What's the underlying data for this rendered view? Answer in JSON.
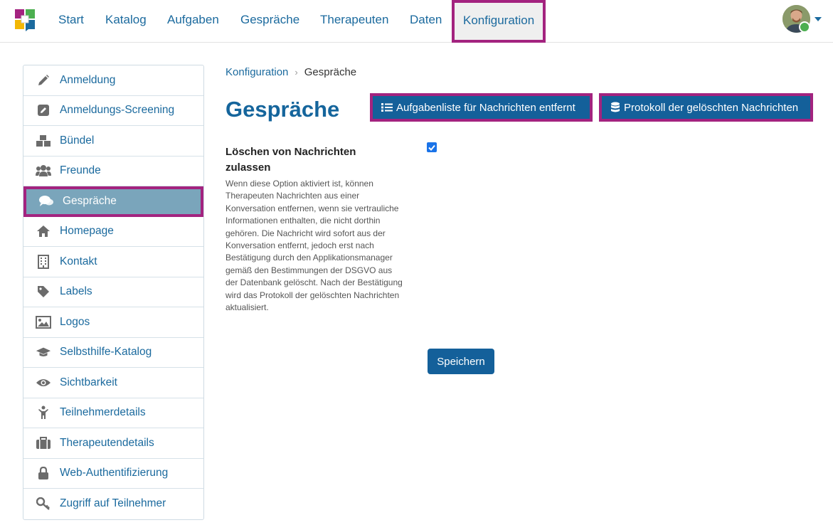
{
  "nav": {
    "items": [
      {
        "label": "Start"
      },
      {
        "label": "Katalog"
      },
      {
        "label": "Aufgaben"
      },
      {
        "label": "Gespräche"
      },
      {
        "label": "Therapeuten"
      },
      {
        "label": "Daten"
      },
      {
        "label": "Konfiguration",
        "active": true
      }
    ],
    "logo_icon": "app-logo",
    "user_menu_icon": "chevron-down-icon"
  },
  "sidebar": {
    "items": [
      {
        "label": "Anmeldung",
        "icon": "pencil-icon"
      },
      {
        "label": "Anmeldungs-Screening",
        "icon": "edit-square-icon"
      },
      {
        "label": "Bündel",
        "icon": "cubes-icon"
      },
      {
        "label": "Freunde",
        "icon": "users-icon"
      },
      {
        "label": "Gespräche",
        "icon": "comments-icon",
        "active": true
      },
      {
        "label": "Homepage",
        "icon": "home-icon"
      },
      {
        "label": "Kontakt",
        "icon": "building-icon"
      },
      {
        "label": "Labels",
        "icon": "tag-icon"
      },
      {
        "label": "Logos",
        "icon": "image-icon"
      },
      {
        "label": "Selbsthilfe-Katalog",
        "icon": "graduation-cap-icon"
      },
      {
        "label": "Sichtbarkeit",
        "icon": "eye-icon"
      },
      {
        "label": "Teilnehmerdetails",
        "icon": "child-icon"
      },
      {
        "label": "Therapeutendetails",
        "icon": "briefcase-icon"
      },
      {
        "label": "Web-Authentifizierung",
        "icon": "lock-icon"
      },
      {
        "label": "Zugriff auf Teilnehmer",
        "icon": "key-icon"
      }
    ]
  },
  "breadcrumb": {
    "parent": "Konfiguration",
    "current": "Gespräche"
  },
  "page": {
    "title": "Gespräche",
    "buttons": {
      "task_list": "Aufgabenliste für Nachrichten entfernt",
      "deleted_log": "Protokoll der gelöschten Nachrichten"
    }
  },
  "setting": {
    "label": "Löschen von Nachrichten zulassen",
    "description": "Wenn diese Option aktiviert ist, können Therapeuten Nachrichten aus einer Konversation entfernen, wenn sie vertrauliche Informationen enthalten, die nicht dorthin gehören. Die Nachricht wird sofort aus der Konversation entfernt, jedoch erst nach Bestätigung durch den Applikationsmanager gemäß den Bestimmungen der DSGVO aus der Datenbank gelöscht. Nach der Bestätigung wird das Protokoll der gelöschten Nachrichten aktualisiert.",
    "checked": true
  },
  "save_label": "Speichern",
  "colors": {
    "accent": "#14609a",
    "link": "#1b6a9e",
    "highlight": "#a3237f",
    "active_sidebar": "#7aa5bb"
  }
}
